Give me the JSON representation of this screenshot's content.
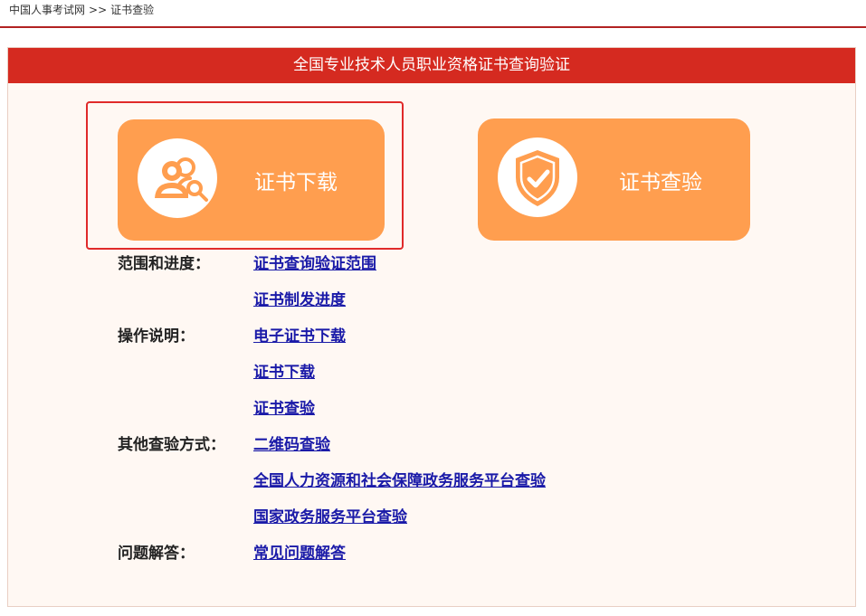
{
  "breadcrumb": {
    "home": "中国人事考试网",
    "separator": ">>",
    "current": "证书查验"
  },
  "panel": {
    "title": "全国专业技术人员职业资格证书查询验证"
  },
  "tiles": {
    "download": {
      "label": "证书下载",
      "icon": "user-search-icon"
    },
    "verify": {
      "label": "证书查验",
      "icon": "shield-check-icon"
    }
  },
  "info": {
    "scope_label": "范围和进度：",
    "scope_link_1": "证书查询验证范围",
    "scope_link_2": "证书制发进度",
    "ops_label": "操作说明：",
    "ops_link_1": "电子证书下载",
    "ops_link_2": "证书下载",
    "ops_link_3": "证书查验",
    "other_label": "其他查验方式：",
    "other_link_1": "二维码查验",
    "other_link_2": "全国人力资源和社会保障政务服务平台查验",
    "other_link_3": "国家政务服务平台查验",
    "faq_label": "问题解答：",
    "faq_link_1": "常见问题解答"
  },
  "colors": {
    "header_red": "#d52a20",
    "tile_orange": "#ff9e4f",
    "link_blue": "#1a1aa8",
    "highlight_red": "#e02a2a"
  }
}
